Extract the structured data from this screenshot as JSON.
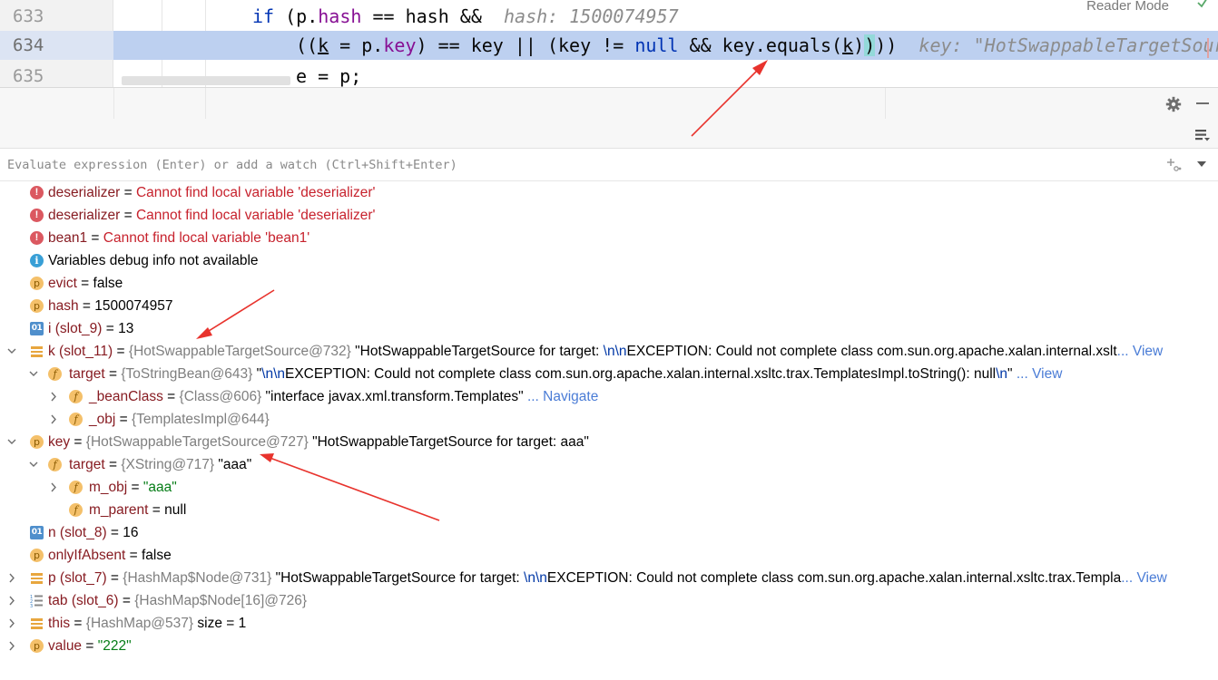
{
  "editor": {
    "reader_mode_label": "Reader Mode",
    "lines": [
      {
        "number": "633",
        "tokens": [
          {
            "t": "if",
            "c": "kw"
          },
          {
            "t": " (p.",
            "c": ""
          },
          {
            "t": "hash",
            "c": "fld"
          },
          {
            "t": " == hash &&  ",
            "c": ""
          },
          {
            "t": "hash: 1500074957",
            "c": "hint"
          }
        ]
      },
      {
        "number": "634",
        "tokens": [
          {
            "t": "((",
            "c": ""
          },
          {
            "t": "k",
            "c": "ul"
          },
          {
            "t": " = p.",
            "c": ""
          },
          {
            "t": "key",
            "c": "fld"
          },
          {
            "t": ") == key || (key != ",
            "c": ""
          },
          {
            "t": "null",
            "c": "kw"
          },
          {
            "t": " && key.equals(",
            "c": ""
          },
          {
            "t": "k",
            "c": "ul"
          },
          {
            "t": ")",
            "c": ""
          },
          {
            "t": ")",
            "c": "paren-hl"
          },
          {
            "t": "))  ",
            "c": ""
          },
          {
            "t": "key: \"HotSwappableTargetSource for target: aaa\"",
            "c": "hint"
          }
        ]
      },
      {
        "number": "635",
        "tokens": [
          {
            "t": "e = p;",
            "c": ""
          }
        ]
      }
    ]
  },
  "toolbar": {
    "gear_icon": "gear-icon",
    "minimize_icon": "minimize-icon",
    "layout_icon": "layout-icon"
  },
  "evaluate": {
    "placeholder": "Evaluate expression (Enter) or add a watch (Ctrl+Shift+Enter)",
    "add_watch_icon": "add-watch-icon",
    "dropdown_icon": "chevron-down-icon"
  },
  "variables": [
    {
      "depth": 0,
      "expand": "",
      "icon": "error",
      "name": "deserializer",
      "eq": " = ",
      "parts": [
        {
          "t": "Cannot find local variable 'deserializer'",
          "c": "errmsg"
        }
      ]
    },
    {
      "depth": 0,
      "expand": "",
      "icon": "error",
      "name": "deserializer",
      "eq": " = ",
      "parts": [
        {
          "t": "Cannot find local variable 'deserializer'",
          "c": "errmsg"
        }
      ]
    },
    {
      "depth": 0,
      "expand": "",
      "icon": "error",
      "name": "bean1",
      "eq": " = ",
      "parts": [
        {
          "t": "Cannot find local variable 'bean1'",
          "c": "errmsg"
        }
      ]
    },
    {
      "depth": 0,
      "expand": "",
      "icon": "info",
      "name": "Variables debug info not available",
      "eq": "",
      "parts": []
    },
    {
      "depth": 0,
      "expand": "",
      "icon": "p",
      "name": "evict",
      "eq": " = ",
      "parts": [
        {
          "t": "false",
          "c": "plain"
        }
      ]
    },
    {
      "depth": 0,
      "expand": "",
      "icon": "p",
      "name": "hash",
      "eq": " = ",
      "parts": [
        {
          "t": "1500074957",
          "c": "plain"
        }
      ]
    },
    {
      "depth": 0,
      "expand": "",
      "icon": "o1",
      "name": "i (slot_9)",
      "eq": " = ",
      "parts": [
        {
          "t": "13",
          "c": "plain"
        }
      ]
    },
    {
      "depth": 0,
      "expand": "down",
      "icon": "obj",
      "name": "k (slot_11)",
      "eq": " = ",
      "parts": [
        {
          "t": "{HotSwappableTargetSource@732}",
          "c": "ref"
        },
        {
          "t": " \"HotSwappableTargetSource for target: ",
          "c": "strv"
        },
        {
          "t": "\\n\\n",
          "c": "esc"
        },
        {
          "t": "EXCEPTION: Could not complete class com.sun.org.apache.xalan.internal.xslt",
          "c": "strv"
        },
        {
          "t": "... View",
          "c": "link"
        }
      ]
    },
    {
      "depth": 1,
      "expand": "down",
      "icon": "f",
      "name": "target",
      "eq": " = ",
      "parts": [
        {
          "t": "{ToStringBean@643}",
          "c": "ref"
        },
        {
          "t": " \"",
          "c": "strv"
        },
        {
          "t": "\\n\\n",
          "c": "esc"
        },
        {
          "t": "EXCEPTION: Could not complete class com.sun.org.apache.xalan.internal.xsltc.trax.TemplatesImpl.toString(): null",
          "c": "strv"
        },
        {
          "t": "\\n",
          "c": "esc"
        },
        {
          "t": "\" ",
          "c": "strv"
        },
        {
          "t": "... View",
          "c": "link"
        }
      ]
    },
    {
      "depth": 2,
      "expand": "right",
      "icon": "f",
      "name": "_beanClass",
      "eq": " = ",
      "parts": [
        {
          "t": "{Class@606}",
          "c": "ref"
        },
        {
          "t": " \"interface javax.xml.transform.Templates\" ",
          "c": "strv"
        },
        {
          "t": "... Navigate",
          "c": "link"
        }
      ]
    },
    {
      "depth": 2,
      "expand": "right",
      "icon": "f",
      "name": "_obj",
      "eq": " = ",
      "parts": [
        {
          "t": "{TemplatesImpl@644}",
          "c": "ref"
        }
      ]
    },
    {
      "depth": 0,
      "expand": "down",
      "icon": "p",
      "name": "key",
      "eq": " = ",
      "parts": [
        {
          "t": "{HotSwappableTargetSource@727}",
          "c": "ref"
        },
        {
          "t": " \"HotSwappableTargetSource for target: aaa\"",
          "c": "strv"
        }
      ]
    },
    {
      "depth": 1,
      "expand": "down",
      "icon": "f",
      "name": "target",
      "eq": " = ",
      "parts": [
        {
          "t": "{XString@717}",
          "c": "ref"
        },
        {
          "t": " \"aaa\"",
          "c": "strv"
        }
      ]
    },
    {
      "depth": 2,
      "expand": "right",
      "icon": "f",
      "name": "m_obj",
      "eq": " = ",
      "parts": [
        {
          "t": "\"aaa\"",
          "c": "str"
        }
      ]
    },
    {
      "depth": 2,
      "expand": "",
      "icon": "f",
      "name": "m_parent",
      "eq": " = ",
      "parts": [
        {
          "t": "null",
          "c": "plain"
        }
      ]
    },
    {
      "depth": 0,
      "expand": "",
      "icon": "o1",
      "name": "n (slot_8)",
      "eq": " = ",
      "parts": [
        {
          "t": "16",
          "c": "plain"
        }
      ]
    },
    {
      "depth": 0,
      "expand": "",
      "icon": "p",
      "name": "onlyIfAbsent",
      "eq": " = ",
      "parts": [
        {
          "t": "false",
          "c": "plain"
        }
      ]
    },
    {
      "depth": 0,
      "expand": "right",
      "icon": "obj",
      "name": "p (slot_7)",
      "eq": " = ",
      "parts": [
        {
          "t": "{HashMap$Node@731}",
          "c": "ref"
        },
        {
          "t": " \"HotSwappableTargetSource for target: ",
          "c": "strv"
        },
        {
          "t": "\\n\\n",
          "c": "esc"
        },
        {
          "t": "EXCEPTION: Could not complete class com.sun.org.apache.xalan.internal.xsltc.trax.Templa",
          "c": "strv"
        },
        {
          "t": "... View",
          "c": "link"
        }
      ]
    },
    {
      "depth": 0,
      "expand": "right",
      "icon": "arr",
      "name": "tab (slot_6)",
      "eq": " = ",
      "parts": [
        {
          "t": "{HashMap$Node[16]@726}",
          "c": "ref"
        }
      ]
    },
    {
      "depth": 0,
      "expand": "right",
      "icon": "obj",
      "name": "this",
      "eq": " = ",
      "parts": [
        {
          "t": "{HashMap@537}",
          "c": "ref"
        },
        {
          "t": "  size = 1",
          "c": "strv"
        }
      ]
    },
    {
      "depth": 0,
      "expand": "right",
      "icon": "p",
      "name": "value",
      "eq": " = ",
      "parts": [
        {
          "t": "\"222\"",
          "c": "str"
        }
      ]
    }
  ],
  "colors": {
    "annotation_arrow": "#e8332d",
    "current_line": "#bdd0f0",
    "error_text": "#c7222d",
    "link": "#4a7cd6"
  }
}
